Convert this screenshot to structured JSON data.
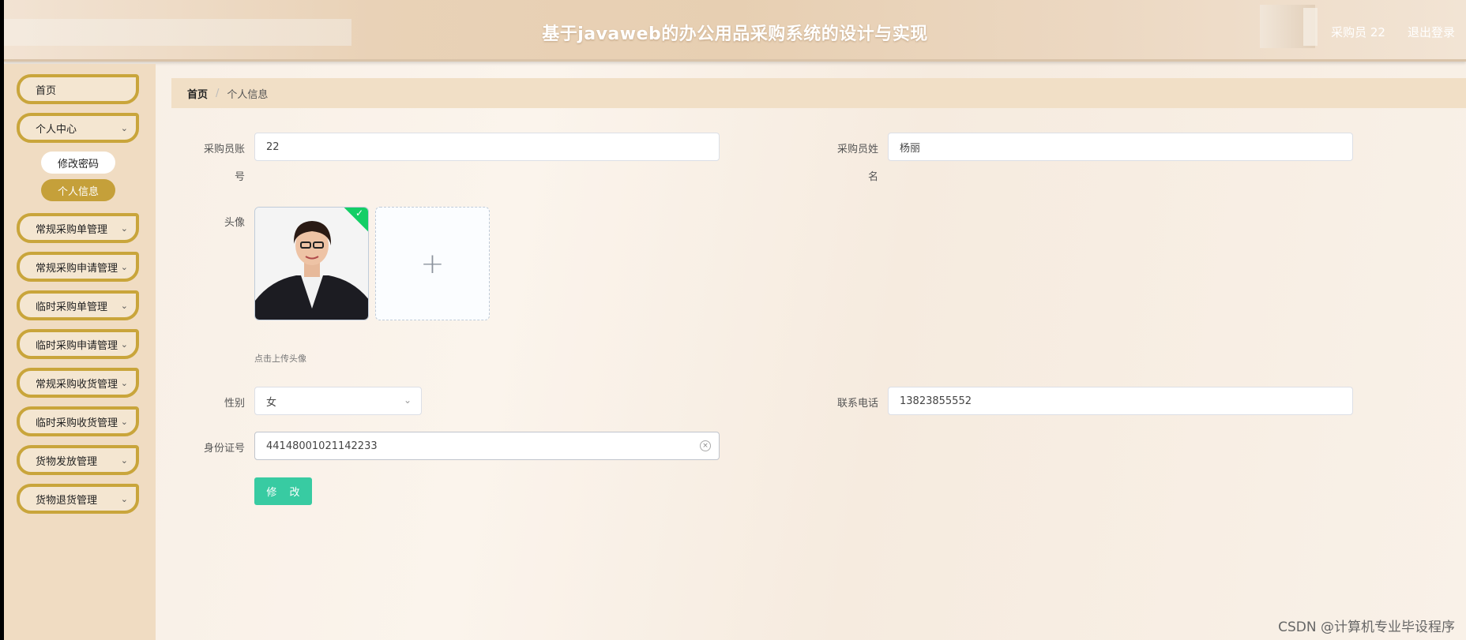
{
  "header": {
    "title": "基于javaweb的办公用品采购系统的设计与实现",
    "user": "采购员 22",
    "logout": "退出登录"
  },
  "sidebar": {
    "items": [
      {
        "label": "首页",
        "has_chevron": false
      },
      {
        "label": "个人中心",
        "has_chevron": true
      },
      {
        "label": "常规采购单管理",
        "has_chevron": true
      },
      {
        "label": "常规采购申请管理",
        "has_chevron": true
      },
      {
        "label": "临时采购单管理",
        "has_chevron": true
      },
      {
        "label": "临时采购申请管理",
        "has_chevron": true
      },
      {
        "label": "常规采购收货管理",
        "has_chevron": true
      },
      {
        "label": "临时采购收货管理",
        "has_chevron": true
      },
      {
        "label": "货物发放管理",
        "has_chevron": true
      },
      {
        "label": "货物退货管理",
        "has_chevron": true
      }
    ],
    "submenu": [
      {
        "label": "修改密码",
        "active": false
      },
      {
        "label": "个人信息",
        "active": true
      }
    ]
  },
  "breadcrumb": {
    "home": "首页",
    "separator": "/",
    "current": "个人信息"
  },
  "form": {
    "account_label_1": "采购员账",
    "account_label_2": "号",
    "account_value": "22",
    "name_label_1": "采购员姓",
    "name_label_2": "名",
    "name_value": "杨丽",
    "avatar_label": "头像",
    "upload_tip": "点击上传头像",
    "gender_label": "性别",
    "gender_value": "女",
    "phone_label": "联系电话",
    "phone_value": "13823855552",
    "id_label": "身份证号",
    "id_value": "441480​01021142233",
    "submit": "修 改"
  },
  "icons": {
    "chevron": "chevron-down-icon",
    "plus": "plus-icon",
    "check": "check-icon",
    "clear": "circle-close-icon"
  },
  "colors": {
    "accent_gold": "#c5a03a",
    "button_green": "#38cba2",
    "success_green": "#13ce66"
  },
  "watermark": "CSDN @计算机专业毕设程序"
}
